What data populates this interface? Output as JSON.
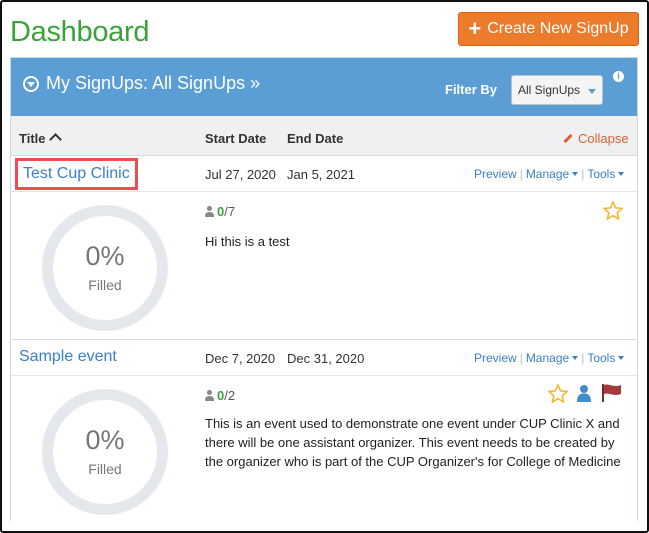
{
  "page": {
    "title": "Dashboard"
  },
  "create_button": {
    "label": "Create New SignUp",
    "icon": "plus-icon"
  },
  "panel": {
    "title": "My SignUps: All SignUps »",
    "filter_label": "Filter By",
    "filter_value": "All SignUps",
    "info_icon": "i"
  },
  "columns": {
    "title": "Title",
    "start": "Start Date",
    "end": "End Date",
    "collapse": "Collapse"
  },
  "actions": {
    "preview": "Preview",
    "manage": "Manage",
    "tools": "Tools"
  },
  "events": [
    {
      "title": "Test Cup Clinic",
      "start": "Jul 27, 2020",
      "end": "Jan 5, 2021",
      "filled_count": "0",
      "total": "/7",
      "percent": "0%",
      "filled_label": "Filled",
      "description": "Hi this is a test",
      "icons": [
        "star-icon"
      ]
    },
    {
      "title": "Sample event",
      "start": "Dec 7, 2020",
      "end": "Dec 31, 2020",
      "filled_count": "0",
      "total": "/2",
      "percent": "0%",
      "filled_label": "Filled",
      "description": "This is an event used to demonstrate one event under CUP Clinic X and there will be one assistant organizer. This event needs to be created by the organizer who is part of the CUP Organizer's for College of Medicine",
      "icons": [
        "star-icon",
        "user-icon",
        "flag-icon"
      ]
    }
  ],
  "colors": {
    "accent_green": "#3aa33a",
    "button_orange": "#ec7b2c",
    "header_blue": "#5b9ed6",
    "link_blue": "#3a80c7",
    "highlight_red": "#ef4d50",
    "star_gold": "#f2b632",
    "flag_red": "#a23b3b"
  }
}
